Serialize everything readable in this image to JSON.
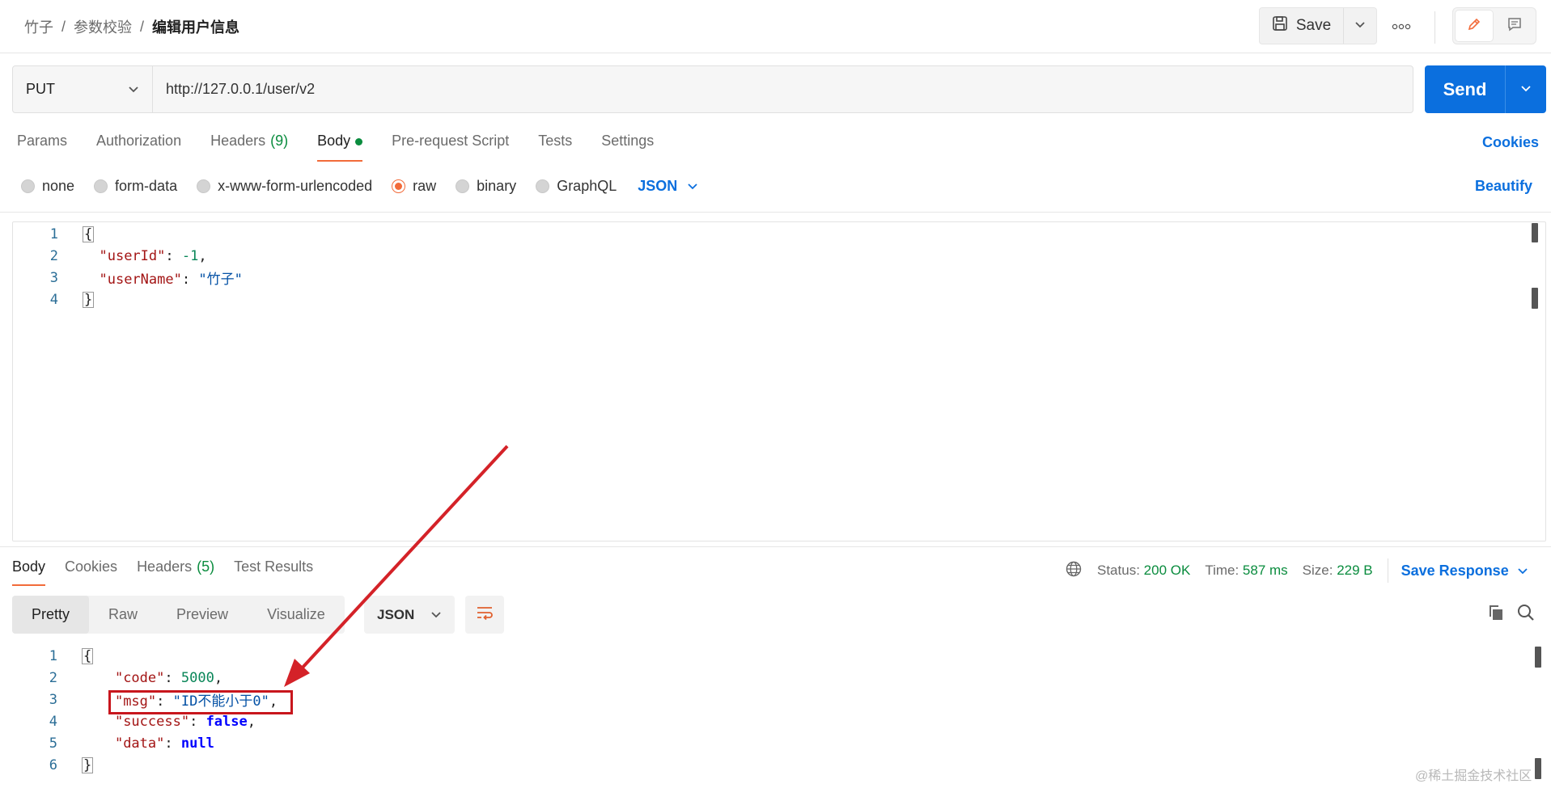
{
  "breadcrumb": {
    "items": [
      "竹子",
      "参数校验"
    ],
    "separator": "/",
    "current": "编辑用户信息"
  },
  "toolbar": {
    "save_label": "Save"
  },
  "request": {
    "method": "PUT",
    "url": "http://127.0.0.1/user/v2",
    "send_label": "Send"
  },
  "request_tabs": [
    {
      "label": "Params"
    },
    {
      "label": "Authorization"
    },
    {
      "label": "Headers",
      "count": "(9)"
    },
    {
      "label": "Body",
      "active": true
    },
    {
      "label": "Pre-request Script"
    },
    {
      "label": "Tests"
    },
    {
      "label": "Settings"
    }
  ],
  "cookies_label": "Cookies",
  "body_types": {
    "options": [
      "none",
      "form-data",
      "x-www-form-urlencoded",
      "raw",
      "binary",
      "GraphQL"
    ],
    "selected": "raw",
    "language": "JSON",
    "beautify_label": "Beautify"
  },
  "request_body_lines": [
    {
      "n": "1",
      "text": "{"
    },
    {
      "n": "2",
      "key": "\"userId\"",
      "value": "-1",
      "trail": ","
    },
    {
      "n": "3",
      "key": "\"userName\"",
      "value": "\"竹子\"",
      "trail": ""
    },
    {
      "n": "4",
      "text": "}"
    }
  ],
  "response_tabs": [
    {
      "label": "Body",
      "active": true
    },
    {
      "label": "Cookies"
    },
    {
      "label": "Headers",
      "count": "(5)"
    },
    {
      "label": "Test Results"
    }
  ],
  "response_meta": {
    "status_label": "Status:",
    "status_value": "200 OK",
    "time_label": "Time:",
    "time_value": "587 ms",
    "size_label": "Size:",
    "size_value": "229 B",
    "save_response_label": "Save Response"
  },
  "view_modes": [
    "Pretty",
    "Raw",
    "Preview",
    "Visualize"
  ],
  "response_language": "JSON",
  "response_body_lines": [
    {
      "n": "1",
      "text": "{"
    },
    {
      "n": "2",
      "key": "\"code\"",
      "value": "5000",
      "trail": ","
    },
    {
      "n": "3",
      "key": "\"msg\"",
      "value": "\"ID不能小于0\"",
      "trail": ","
    },
    {
      "n": "4",
      "key": "\"success\"",
      "value": "false",
      "trail": ","
    },
    {
      "n": "5",
      "key": "\"data\"",
      "value": "null",
      "trail": ""
    },
    {
      "n": "6",
      "text": "}"
    }
  ],
  "watermark": "@稀土掘金技术社区",
  "colors": {
    "accent": "#0b6fde",
    "tab_indicator": "#f26b3a",
    "status_ok": "#0a8c3e",
    "annotation": "#c8161d"
  }
}
